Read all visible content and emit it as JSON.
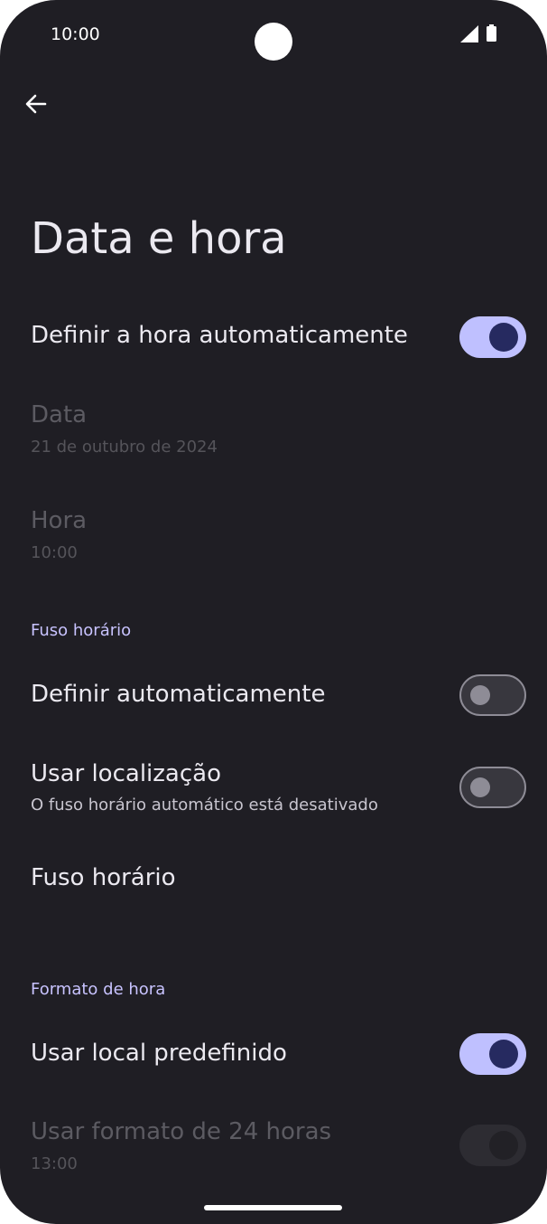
{
  "status_bar": {
    "time": "10:00"
  },
  "page": {
    "title": "Data e hora"
  },
  "auto_time": {
    "label": "Definir a hora automaticamente",
    "state": "on"
  },
  "date": {
    "label": "Data",
    "value": "21 de outubro de 2024"
  },
  "hour": {
    "label": "Hora",
    "value": "10:00"
  },
  "timezone_section": {
    "header": "Fuso horário"
  },
  "auto_timezone": {
    "label": "Definir automaticamente",
    "state": "off"
  },
  "use_location": {
    "label": "Usar localização",
    "summary": "O fuso horário automático está desativado",
    "state": "off"
  },
  "timezone": {
    "label": "Fuso horário"
  },
  "time_format_section": {
    "header": "Formato de hora"
  },
  "use_locale_default": {
    "label": "Usar local predefinido",
    "state": "on"
  },
  "use_24h": {
    "label": "Usar formato de 24 horas",
    "value": "13:00",
    "state": "disabled-on"
  },
  "colors": {
    "background": "#1f1e24",
    "accent": "#bfc0ff",
    "knob_on": "#262a60",
    "section_header": "#c8c3ff"
  },
  "icons": {
    "back": "arrow-back-icon",
    "signal": "cell-signal-icon",
    "battery": "battery-icon"
  }
}
